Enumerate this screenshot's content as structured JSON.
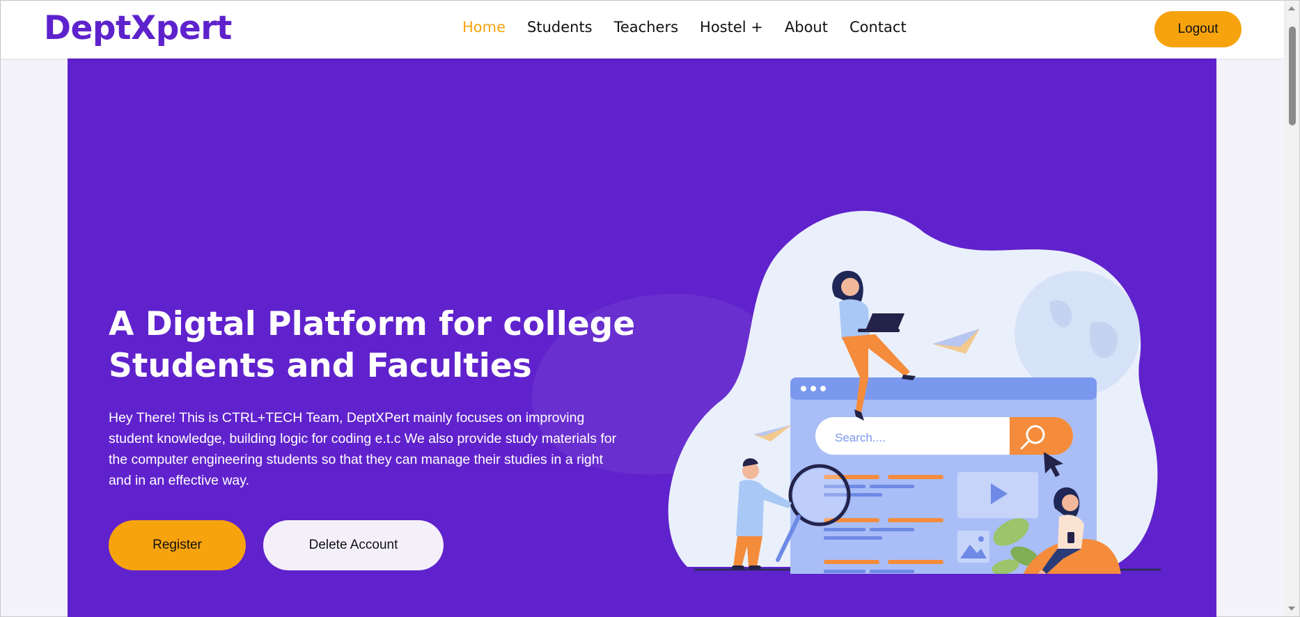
{
  "header": {
    "logo": "DeptXpert",
    "nav": [
      {
        "label": "Home",
        "active": true
      },
      {
        "label": "Students",
        "active": false
      },
      {
        "label": "Teachers",
        "active": false
      },
      {
        "label": "Hostel +",
        "active": false
      },
      {
        "label": "About",
        "active": false
      },
      {
        "label": "Contact",
        "active": false
      }
    ],
    "logout_label": "Logout"
  },
  "hero": {
    "title_line1": "A Digtal Platform for college",
    "title_line2": "Students and Faculties",
    "description": "Hey There! This is CTRL+TECH Team, DeptXPert mainly focuses on improving student knowledge, building logic for coding e.t.c We also provide study materials for the computer engineering students so that they can manage their studies in a right and in an effective way.",
    "register_label": "Register",
    "delete_label": "Delete Account",
    "illustration": {
      "search_placeholder": "Search....",
      "icons": [
        "search-icon",
        "play-icon",
        "image-icon",
        "cursor-icon"
      ]
    }
  },
  "colors": {
    "brand": "#5e22cc",
    "hero_bg": "#6022cc",
    "accent": "#f7a30e",
    "light_button": "#f4f0fa"
  }
}
